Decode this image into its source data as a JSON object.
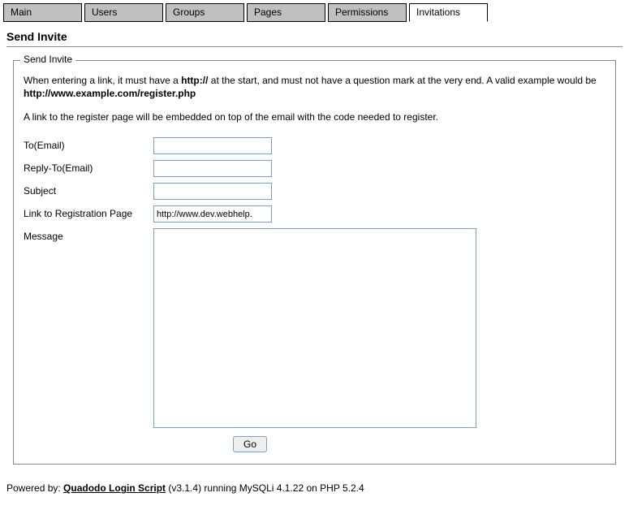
{
  "tabs": {
    "items": [
      {
        "label": "Main"
      },
      {
        "label": "Users"
      },
      {
        "label": "Groups"
      },
      {
        "label": "Pages"
      },
      {
        "label": "Permissions"
      },
      {
        "label": "Invitations"
      }
    ]
  },
  "heading": "Send Invite",
  "legend": "Send Invite",
  "info": {
    "part1": "When entering a link, it must have a ",
    "bold1": "http://",
    "part2": " at the start, and must not have a question mark at the very end. A valid example would be ",
    "bold2": "http://www.example.com/register.php"
  },
  "info2": "A link to the register page will be embedded on top of the email with the code needed to register.",
  "form": {
    "to_label": "To(Email)",
    "replyto_label": "Reply-To(Email)",
    "subject_label": "Subject",
    "link_label": "Link to Registration Page",
    "link_value": "http://www.dev.webhelp.",
    "message_label": "Message",
    "go_label": "Go"
  },
  "footer": {
    "text1": "Powered by: ",
    "link": "Quadodo Login Script",
    "text2": " (v3.1.4) running MySQLi 4.1.22 on PHP 5.2.4"
  }
}
